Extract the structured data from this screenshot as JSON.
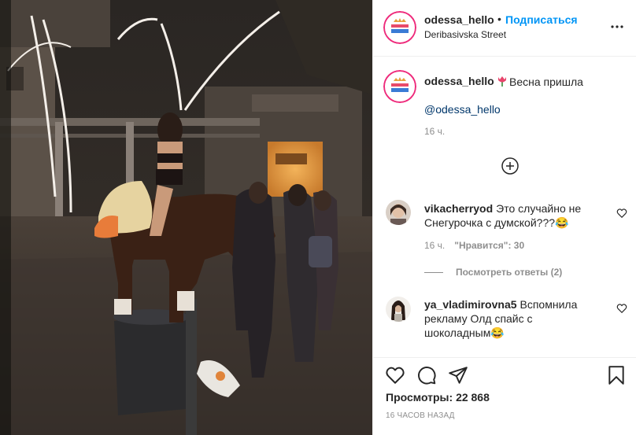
{
  "post": {
    "username": "odessa_hello",
    "separator": "•",
    "follow_label": "Подписаться",
    "location": "Deribasivska Street",
    "more_icon": "more-horizontal-icon"
  },
  "avatar_logo": {
    "line1": "ПРИВЕТ",
    "line2": "ОДЕССА",
    "colors": [
      "#ee2a7b",
      "#f9ce34",
      "#6228d7"
    ]
  },
  "caption": {
    "username": "odessa_hello",
    "emoji_icon": "tulip-icon",
    "text": "Весна пришла",
    "mention": "@odessa_hello",
    "time": "16 ч."
  },
  "load_more_icon": "plus-circle-icon",
  "comments": [
    {
      "username": "vikacherryod",
      "text": "Это случайно не Снегурочка с думской???😂",
      "time": "16 ч.",
      "likes": "\"Нравится\": 30",
      "replies": "Посмотреть ответы (2)"
    },
    {
      "username": "ya_vladimirovna5",
      "text": "Вспомнила рекламу Олд спайс с шоколадным😂"
    }
  ],
  "actions": {
    "like_icon": "heart-icon",
    "comment_icon": "comment-icon",
    "share_icon": "paper-plane-icon",
    "save_icon": "bookmark-icon",
    "views_label": "Просмотры:",
    "views_count": "22 868",
    "date": "16 ЧАСОВ НАЗАД"
  },
  "colors": {
    "accent": "#0095f6",
    "text": "#262626",
    "secondary": "#8e8e8e",
    "mention": "#00376b",
    "border": "#efefef"
  }
}
